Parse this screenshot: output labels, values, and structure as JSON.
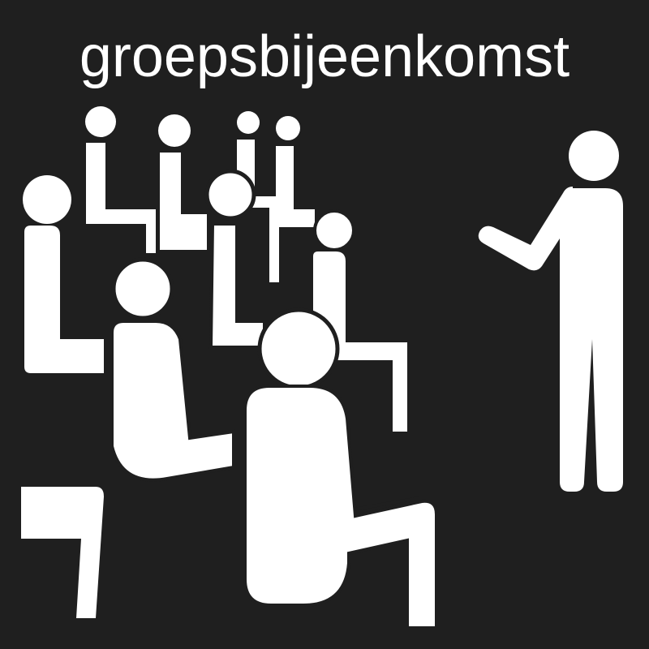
{
  "title": "groepsbijeenkomst",
  "colors": {
    "background": "#1f1f1f",
    "figure": "#ffffff"
  },
  "icons": {
    "audience": "seated-people-icon",
    "speaker": "standing-presenter-icon"
  }
}
